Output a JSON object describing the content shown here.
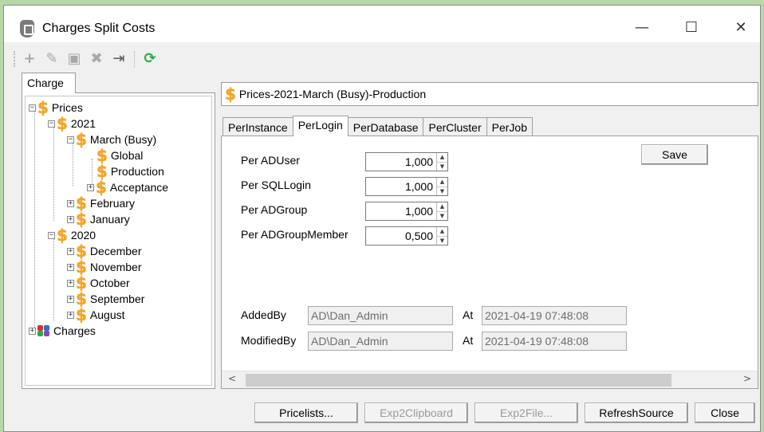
{
  "window": {
    "title": "Charges Split Costs",
    "controls": {
      "minimize": "—",
      "maximize": "☐",
      "close": "✕"
    }
  },
  "toolbar": {
    "items": [
      {
        "name": "add-icon",
        "glyph": "+"
      },
      {
        "name": "edit-icon",
        "glyph": "✎"
      },
      {
        "name": "save-icon",
        "glyph": "▣"
      },
      {
        "name": "delete-icon",
        "glyph": "✖"
      },
      {
        "name": "exit-icon",
        "glyph": "⇥"
      },
      {
        "name": "refresh-icon",
        "glyph": "⟳"
      }
    ]
  },
  "left_tab": {
    "label": "Charge"
  },
  "tree": {
    "prices": "Prices",
    "y2021": "2021",
    "march": "March (Busy)",
    "global": "Global",
    "production": "Production",
    "acceptance": "Acceptance",
    "february": "February",
    "january": "January",
    "y2020": "2020",
    "december": "December",
    "november": "November",
    "october": "October",
    "september": "September",
    "august": "August",
    "charges": "Charges"
  },
  "path": {
    "value": "Prices-2021-March (Busy)-Production"
  },
  "tabs": [
    "PerInstance",
    "PerLogin",
    "PerDatabase",
    "PerCluster",
    "PerJob"
  ],
  "active_tab": "PerLogin",
  "fields": [
    {
      "label": "Per ADUser",
      "value": "1,000"
    },
    {
      "label": "Per SQLLogin",
      "value": "1,000"
    },
    {
      "label": "Per ADGroup",
      "value": "1,000"
    },
    {
      "label": "Per ADGroupMember",
      "value": "0,500"
    }
  ],
  "save_label": "Save",
  "meta": {
    "added_by_label": "AddedBy",
    "added_by": "AD\\Dan_Admin",
    "added_at_label": "At",
    "added_at": "2021-04-19 07:48:08",
    "modified_by_label": "ModifiedBy",
    "modified_by": "AD\\Dan_Admin",
    "modified_at_label": "At",
    "modified_at": "2021-04-19 07:48:08"
  },
  "scroll": {
    "left": "<",
    "right": ">"
  },
  "buttons": {
    "pricelists": "Pricelists...",
    "exp2clipboard": "Exp2Clipboard",
    "exp2file": "Exp2File...",
    "refreshsource": "RefreshSource",
    "close": "Close"
  },
  "colors": {
    "dollar": "#f5a623",
    "refresh": "#2fa84f",
    "background": "#b7d7a8"
  }
}
